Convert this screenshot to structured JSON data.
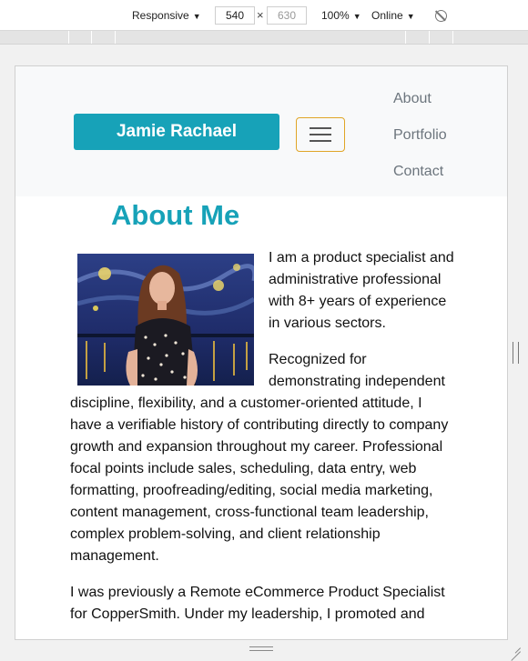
{
  "toolbar": {
    "device": "Responsive",
    "width": "540",
    "times": "×",
    "height": "630",
    "zoom": "100%",
    "throttle": "Online",
    "rotate_icon": "rotate-disabled-icon"
  },
  "site": {
    "brand": "Jamie Rachael",
    "menu_icon": "hamburger-icon",
    "nav_links": [
      "About",
      "Portfolio",
      "Contact"
    ],
    "heading": "About Me",
    "photo_alt": "Portrait photo",
    "paragraphs": [
      "I am a product specialist and administrative professional with 8+ years of experience in various sectors.",
      "Recognized for demonstrating independent discipline, flexibility, and a customer-oriented attitude, I have a verifiable history of contributing directly to company growth and expansion throughout my career. Professional focal points include sales, scheduling, data entry, web formatting, proofreading/editing, social media marketing, content management, cross-functional team leadership, complex problem-solving, and client relationship management.",
      "I was previously a Remote eCommerce Product Specialist for CopperSmith. Under my leadership, I promoted and"
    ]
  },
  "colors": {
    "brand": "#17a2b8",
    "toggler_border": "#e0a526",
    "navbar_bg": "#f8f9fa",
    "nav_link": "#6c757d"
  }
}
